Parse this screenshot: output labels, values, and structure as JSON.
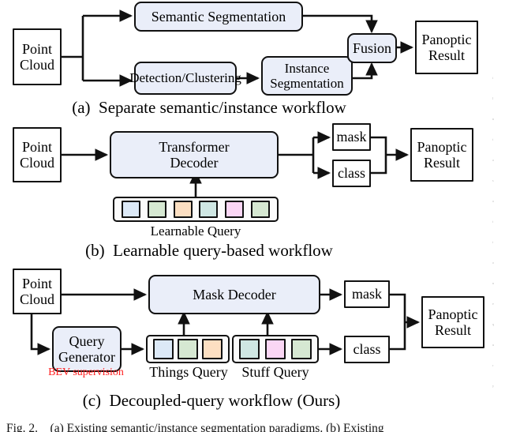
{
  "figure": {
    "title_caption": "Fig. 2.    (a) Existing semantic/instance segmentation paradigms. (b) Existing",
    "panels": [
      {
        "id": "a",
        "caption": "(a)  Separate semantic/instance workflow",
        "nodes": [
          {
            "name": "point-cloud",
            "label": "Point\nCloud"
          },
          {
            "name": "semantic-segmentation",
            "label": "Semantic Segmentation"
          },
          {
            "name": "detection-clustering",
            "label": "Detection/Clustering"
          },
          {
            "name": "instance-segmentation",
            "label": "Instance\nSegmentation"
          },
          {
            "name": "fusion",
            "label": "Fusion"
          },
          {
            "name": "panoptic-result",
            "label": "Panoptic\nResult"
          }
        ]
      },
      {
        "id": "b",
        "caption": "(b)  Learnable query-based workflow",
        "nodes": [
          {
            "name": "point-cloud",
            "label": "Point\nCloud"
          },
          {
            "name": "transformer-decoder",
            "label": "Transformer\nDecoder"
          },
          {
            "name": "mask",
            "label": "mask"
          },
          {
            "name": "class",
            "label": "class"
          },
          {
            "name": "panoptic-result",
            "label": "Panoptic\nResult"
          }
        ],
        "query_strip": {
          "label": "Learnable Query",
          "colors": [
            "#dce9f7",
            "#d6e8d2",
            "#fcdfc2",
            "#cfe7e3",
            "#fad6f4",
            "#d6e8d2"
          ]
        }
      },
      {
        "id": "c",
        "caption": "(c)  Decoupled-query workflow (Ours)",
        "nodes": [
          {
            "name": "point-cloud",
            "label": "Point\nCloud"
          },
          {
            "name": "query-generator",
            "label": "Query\nGenerator"
          },
          {
            "name": "mask-decoder",
            "label": "Mask Decoder"
          },
          {
            "name": "mask",
            "label": "mask"
          },
          {
            "name": "class",
            "label": "class"
          },
          {
            "name": "panoptic-result",
            "label": "Panoptic\nResult"
          }
        ],
        "things_query": {
          "label": "Things Query",
          "colors": [
            "#dce9f7",
            "#d6e8d2",
            "#fcdfc2"
          ]
        },
        "stuff_query": {
          "label": "Stuff Query",
          "colors": [
            "#cfe7e3",
            "#fad6f4",
            "#d6e8d2"
          ]
        },
        "annotation": {
          "label": "BEV supervision",
          "color": "#ff2020"
        }
      }
    ],
    "colors": {
      "box_fill": "#eaeef9",
      "box_stroke": "#111111",
      "page_background": "#ffffff",
      "annotation_red": "#ff2020"
    }
  }
}
